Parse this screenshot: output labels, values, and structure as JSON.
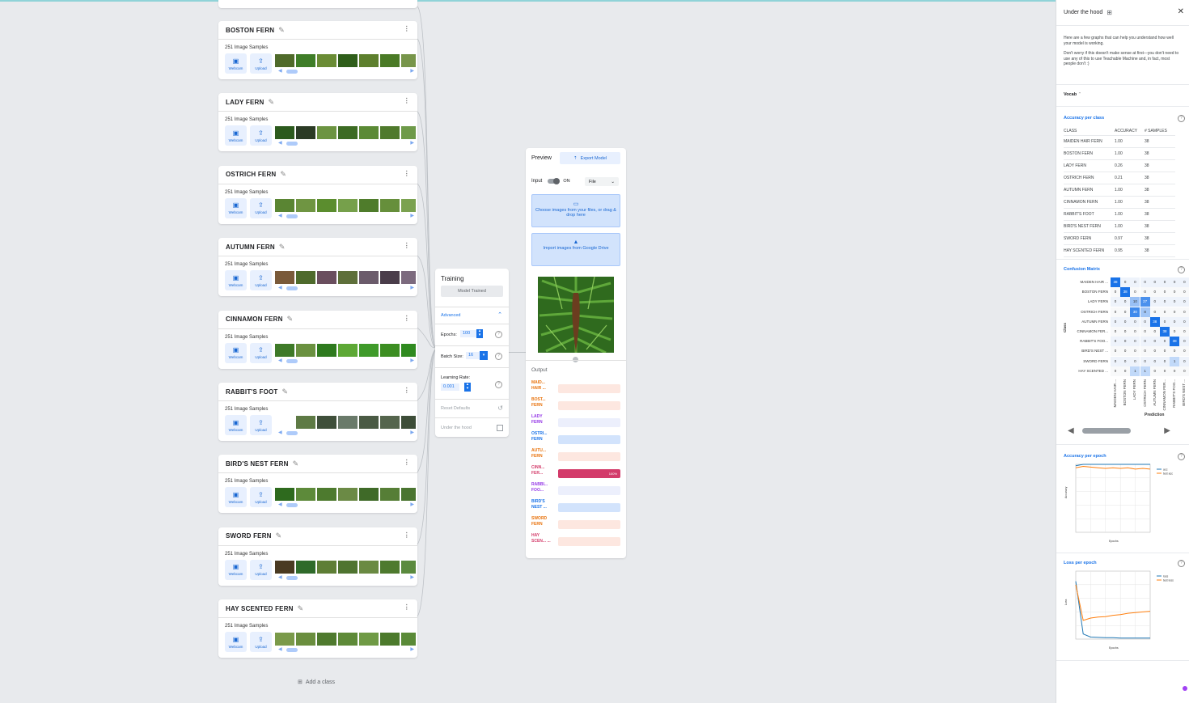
{
  "classes": [
    {
      "name": "BOSTON FERN",
      "samples": "251 Image Samples",
      "webcam": "Webcam",
      "upload": "Upload",
      "thumbs": [
        "#4f6a2a",
        "#3f7d28",
        "#6a8c35",
        "#2f5e1a",
        "#5d7f2d",
        "#4a7a26",
        "#77954a"
      ]
    },
    {
      "name": "LADY FERN",
      "samples": "251 Image Samples",
      "webcam": "Webcam",
      "upload": "Upload",
      "thumbs": [
        "#2c5a1d",
        "#2b3b25",
        "#6c9441",
        "#3c6b23",
        "#5b8a35",
        "#4f7a2c",
        "#6e9a49"
      ]
    },
    {
      "name": "OSTRICH FERN",
      "samples": "251 Image Samples",
      "webcam": "Webcam",
      "upload": "Upload",
      "thumbs": [
        "#5a8533",
        "#6f9542",
        "#5b8d2e",
        "#76a04b",
        "#4f7c2b",
        "#668f3b",
        "#7ba250"
      ]
    },
    {
      "name": "AUTUMN FERN",
      "samples": "251 Image Samples",
      "webcam": "Webcam",
      "upload": "Upload",
      "thumbs": [
        "#7a5a3a",
        "#4e6a2c",
        "#6a4e5e",
        "#5e6f3a",
        "#6b5b6b",
        "#4a3d4a",
        "#7c6a7e"
      ]
    },
    {
      "name": "CINNAMON FERN",
      "samples": "251 Image Samples",
      "webcam": "Webcam",
      "upload": "Upload",
      "thumbs": [
        "#3e7a28",
        "#6a9140",
        "#2e7a1e",
        "#5da835",
        "#3f9a2a",
        "#3c8e22",
        "#2f8a1f"
      ]
    },
    {
      "name": "RABBIT'S FOOT",
      "samples": "251 Image Samples",
      "webcam": "Webcam",
      "upload": "Upload",
      "thumbs": [
        "#ffffff",
        "#5e7a45",
        "#3f4f3a",
        "#6a7a6a",
        "#4a5a44",
        "#55654d",
        "#3d4d38"
      ]
    },
    {
      "name": "BIRD'S NEST FERN",
      "samples": "251 Image Samples",
      "webcam": "Webcam",
      "upload": "Upload",
      "thumbs": [
        "#2e6a1e",
        "#5d8a3a",
        "#4d7a2e",
        "#6b8a45",
        "#3f6a28",
        "#567e36",
        "#4a7430"
      ]
    },
    {
      "name": "SWORD FERN",
      "samples": "251 Image Samples",
      "webcam": "Webcam",
      "upload": "Upload",
      "thumbs": [
        "#4a3a22",
        "#2f6a2a",
        "#5e7e35",
        "#4f7430",
        "#6a8a42",
        "#4e7a2e",
        "#5b8a3e"
      ]
    },
    {
      "name": "HAY SCENTED FERN",
      "samples": "251 Image Samples",
      "webcam": "Webcam",
      "upload": "Upload",
      "thumbs": [
        "#7a9a4a",
        "#6a8e3e",
        "#4f7a2e",
        "#5e8a38",
        "#6f9a45",
        "#4c7a2c",
        "#5a8a37"
      ]
    }
  ],
  "add_class": "Add a class",
  "training": {
    "title": "Training",
    "trained": "Model Trained",
    "advanced": "Advanced",
    "epochs_label": "Epochs:",
    "epochs": "100",
    "batch_label": "Batch Size:",
    "batch": "16",
    "lr_label": "Learning Rate:",
    "lr": "0.001",
    "reset": "Reset Defaults",
    "hood": "Under the hood"
  },
  "preview": {
    "title": "Preview",
    "export": "Export Model",
    "input": "Input",
    "on": "ON",
    "source": "File",
    "choose": "Choose images from your files, or drag & drop here",
    "drive": "Import images from Google Drive",
    "output": "Output",
    "outputs": [
      {
        "label": "MAID... HAIR ...",
        "color": "#e8710a",
        "bar": "#fde7e0",
        "value": 0
      },
      {
        "label": "BOST... FERN",
        "color": "#e8710a",
        "bar": "#fde7e0",
        "value": 0
      },
      {
        "label": "LADY FERN",
        "color": "#9334e6",
        "bar": "#eceffc",
        "value": 0
      },
      {
        "label": "OSTRI... FERN",
        "color": "#1a73e8",
        "bar": "#d2e3fc",
        "value": 0
      },
      {
        "label": "AUTU... FERN",
        "color": "#e8710a",
        "bar": "#fde7e0",
        "value": 0
      },
      {
        "label": "CINN... FER...",
        "color": "#d33b6a",
        "bar": "#d33b6a",
        "value": 100,
        "pct": "100%"
      },
      {
        "label": "RABBI... FOO...",
        "color": "#9334e6",
        "bar": "#eceffc",
        "value": 0
      },
      {
        "label": "BIRD'S NEST ...",
        "color": "#1a73e8",
        "bar": "#d2e3fc",
        "value": 0
      },
      {
        "label": "SWORD FERN",
        "color": "#e8710a",
        "bar": "#fde7e0",
        "value": 0
      },
      {
        "label": "HAY SCEN... ...",
        "color": "#d33b6a",
        "bar": "#fde7e0",
        "value": 0
      }
    ]
  },
  "hood": {
    "title": "Under the hood",
    "intro1": "Here are a few graphs that can help you understand how well your model is working.",
    "intro2": "Don't worry if this doesn't make sense at first—you don't need to use any of this to use Teachable Machine and, in fact, most people don't :)",
    "vocab": "Vocab",
    "acc_title": "Accuracy per class",
    "acc_headers": [
      "CLASS",
      "ACCURACY",
      "# SAMPLES"
    ],
    "acc_rows": [
      [
        "MAIDEN HAIR FERN",
        "1.00",
        "38"
      ],
      [
        "BOSTON FERN",
        "1.00",
        "38"
      ],
      [
        "LADY FERN",
        "0.26",
        "38"
      ],
      [
        "OSTRICH FERN",
        "0.21",
        "38"
      ],
      [
        "AUTUMN FERN",
        "1.00",
        "38"
      ],
      [
        "CINNAMON FERN",
        "1.00",
        "38"
      ],
      [
        "RABBIT'S FOOT",
        "1.00",
        "38"
      ],
      [
        "BIRD'S NEST FERN",
        "1.00",
        "38"
      ],
      [
        "SWORD FERN",
        "0.97",
        "38"
      ],
      [
        "HAY SCENTED FERN",
        "0.95",
        "38"
      ]
    ],
    "cm_title": "Confusion Matrix",
    "cm_labels": [
      "MAIDEN HAIR ...",
      "BOSTON FERN",
      "LADY FERN",
      "OSTRICH FERN",
      "AUTUMN FERN",
      "CINNAMON FER...",
      "RABBIT'S FOO...",
      "BIRD'S NEST ...",
      "SWORD FERN",
      "HAY SCENTED ..."
    ],
    "cm_matrix": [
      [
        38,
        0,
        0,
        0,
        0,
        0,
        0,
        0
      ],
      [
        0,
        38,
        0,
        0,
        0,
        0,
        0,
        0
      ],
      [
        0,
        0,
        10,
        27,
        0,
        0,
        0,
        0
      ],
      [
        0,
        0,
        30,
        8,
        0,
        0,
        0,
        0
      ],
      [
        0,
        0,
        0,
        0,
        38,
        0,
        0,
        0
      ],
      [
        0,
        0,
        0,
        0,
        0,
        38,
        0,
        0
      ],
      [
        0,
        0,
        0,
        0,
        0,
        0,
        38,
        0
      ],
      [
        0,
        0,
        0,
        0,
        0,
        0,
        0,
        0
      ],
      [
        0,
        0,
        0,
        0,
        0,
        0,
        1,
        0
      ],
      [
        0,
        0,
        1,
        1,
        0,
        0,
        0,
        0
      ]
    ],
    "cm_ylabel": "Class",
    "cm_xlabel": "Prediction",
    "acc_epoch_title": "Accuracy per epoch",
    "loss_epoch_title": "Loss per epoch"
  },
  "chart_data": [
    {
      "type": "line",
      "title": "Accuracy per epoch",
      "xlabel": "Epochs",
      "ylabel": "Accuracy",
      "xlim": [
        0,
        100
      ],
      "ylim": [
        0,
        1
      ],
      "series": [
        {
          "name": "acc",
          "color": "#1f77b4",
          "values": [
            0.98,
            1.0,
            1.0,
            1.0,
            1.0,
            1.0,
            1.0,
            1.0,
            1.0,
            1.0,
            1.0
          ]
        },
        {
          "name": "test acc",
          "color": "#ff7f0e",
          "values": [
            0.95,
            0.97,
            0.96,
            0.95,
            0.94,
            0.95,
            0.94,
            0.95,
            0.93,
            0.94,
            0.93
          ]
        }
      ]
    },
    {
      "type": "line",
      "title": "Loss per epoch",
      "xlabel": "Epochs",
      "ylabel": "Loss",
      "xlim": [
        0,
        100
      ],
      "ylim": [
        0,
        2
      ],
      "series": [
        {
          "name": "loss",
          "color": "#1f77b4",
          "values": [
            1.7,
            0.15,
            0.06,
            0.05,
            0.04,
            0.04,
            0.03,
            0.03,
            0.03,
            0.03,
            0.03
          ]
        },
        {
          "name": "test loss",
          "color": "#ff7f0e",
          "values": [
            1.6,
            0.55,
            0.62,
            0.65,
            0.66,
            0.7,
            0.72,
            0.76,
            0.78,
            0.8,
            0.82
          ]
        }
      ]
    }
  ]
}
